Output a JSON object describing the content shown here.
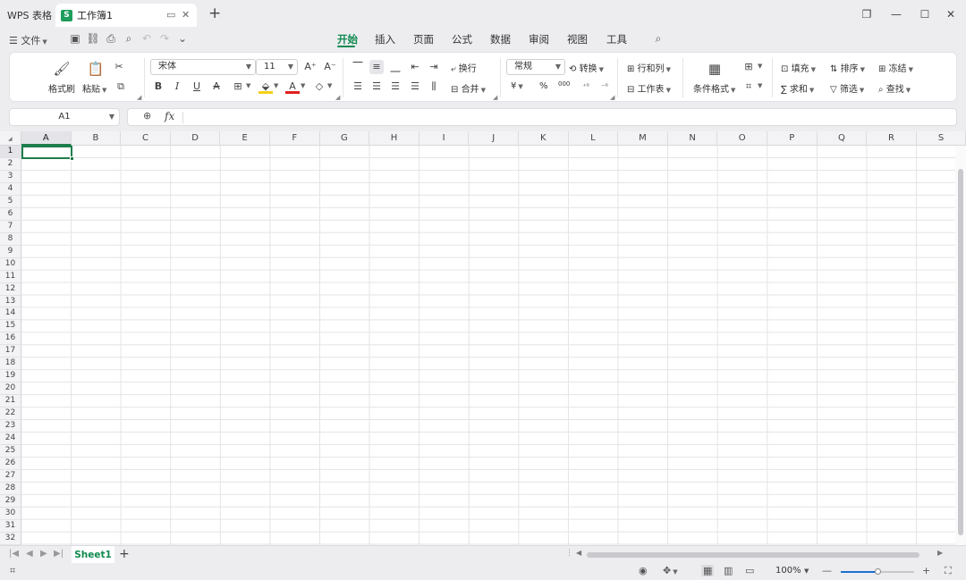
{
  "app": {
    "title": "WPS 表格",
    "document_tab": "工作簿1",
    "doc_icon_letter": "S",
    "new_tab": "+"
  },
  "quickbar": {
    "file_menu": "文件",
    "tabs": [
      "开始",
      "插入",
      "页面",
      "公式",
      "数据",
      "审阅",
      "视图",
      "工具"
    ],
    "active_tab": "开始"
  },
  "ribbon": {
    "format_painter": "格式刷",
    "paste": "粘贴",
    "font_name": "宋体",
    "font_size": "11",
    "bold": "B",
    "italic": "I",
    "underline": "U",
    "strikethrough": "A",
    "font_color": "A",
    "wrap_text": "换行",
    "merge": "合并",
    "number_format": "常规",
    "convert": "转换",
    "currency": "¥",
    "percent": "%",
    "thousands": "000",
    "rows_cols": "行和列",
    "worksheet": "工作表",
    "conditional_format": "条件格式",
    "fill": "填充",
    "sort": "排序",
    "freeze": "冻结",
    "sum": "求和",
    "filter": "筛选",
    "find": "查找"
  },
  "formula_bar": {
    "name_box": "A1",
    "fx": "fx",
    "value": ""
  },
  "grid": {
    "columns": [
      "A",
      "B",
      "C",
      "D",
      "E",
      "F",
      "G",
      "H",
      "I",
      "J",
      "K",
      "L",
      "M",
      "N",
      "O",
      "P",
      "Q",
      "R",
      "S"
    ],
    "rows": [
      "1",
      "2",
      "3",
      "4",
      "5",
      "6",
      "7",
      "8",
      "9",
      "10",
      "11",
      "12",
      "13",
      "14",
      "15",
      "16",
      "17",
      "18",
      "19",
      "20",
      "21",
      "22",
      "23",
      "24",
      "25",
      "26",
      "27",
      "28",
      "29",
      "30",
      "31",
      "32"
    ],
    "active_cell": "A1",
    "accent_color": "#1e7e4a"
  },
  "sheets": {
    "tabs": [
      "Sheet1"
    ],
    "active": "Sheet1",
    "add": "+"
  },
  "status": {
    "zoom": "100%"
  }
}
